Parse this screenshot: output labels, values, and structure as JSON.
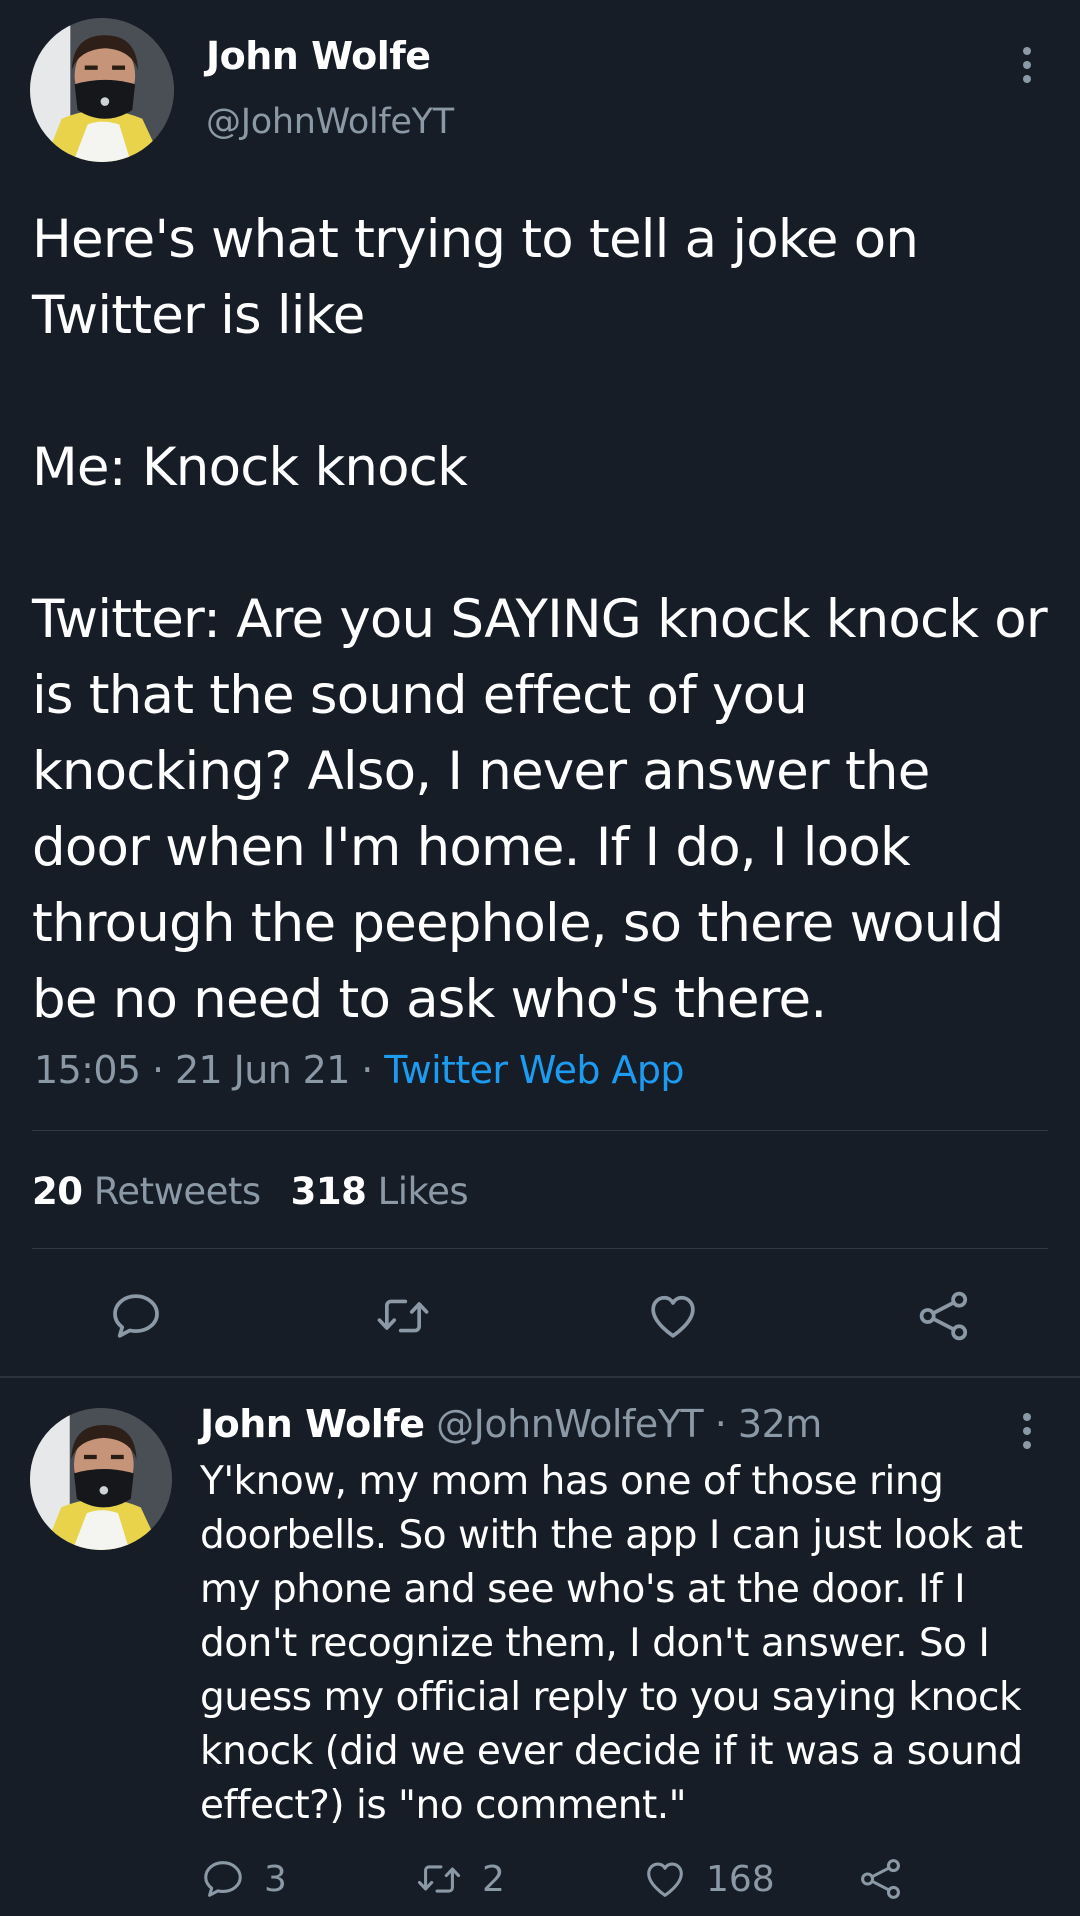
{
  "tweet": {
    "author_name": "John Wolfe",
    "author_handle": "@JohnWolfeYT",
    "text_lines": [
      "Here's what trying to tell a joke on Twitter is like",
      "Me: Knock knock",
      "Twitter: Are you SAYING knock knock or is that the sound effect of you knocking? Also, I never answer the door when I'm home. If I do, I look through the peephole, so there would be no need to ask who's there."
    ],
    "time": "15:05",
    "date": "21 Jun 21",
    "separator": "·",
    "source": "Twitter Web App",
    "retweets_count": "20",
    "retweets_label": "Retweets",
    "likes_count": "318",
    "likes_label": "Likes"
  },
  "reply": {
    "author_name": "John Wolfe",
    "author_handle": "@JohnWolfeYT",
    "separator": "·",
    "time_ago": "32m",
    "text": "Y'know, my mom has one of those ring doorbells. So with the app I can just look at my phone and see who's at the door. If I don't recognize them, I don't answer. So I guess my official reply to you saying knock knock (did we ever decide if it was a sound effect?) is \"no comment.\"",
    "reply_count": "3",
    "retweet_count": "2",
    "like_count": "168"
  },
  "icons": {
    "more": "more-vertical-icon",
    "reply": "reply-bubble-icon",
    "retweet": "retweet-icon",
    "like": "heart-icon",
    "share": "share-icon"
  },
  "colors": {
    "background": "#161d27",
    "text": "#ffffff",
    "muted": "#8b98a5",
    "link": "#1d9bf0",
    "divider": "#2f3a45"
  }
}
